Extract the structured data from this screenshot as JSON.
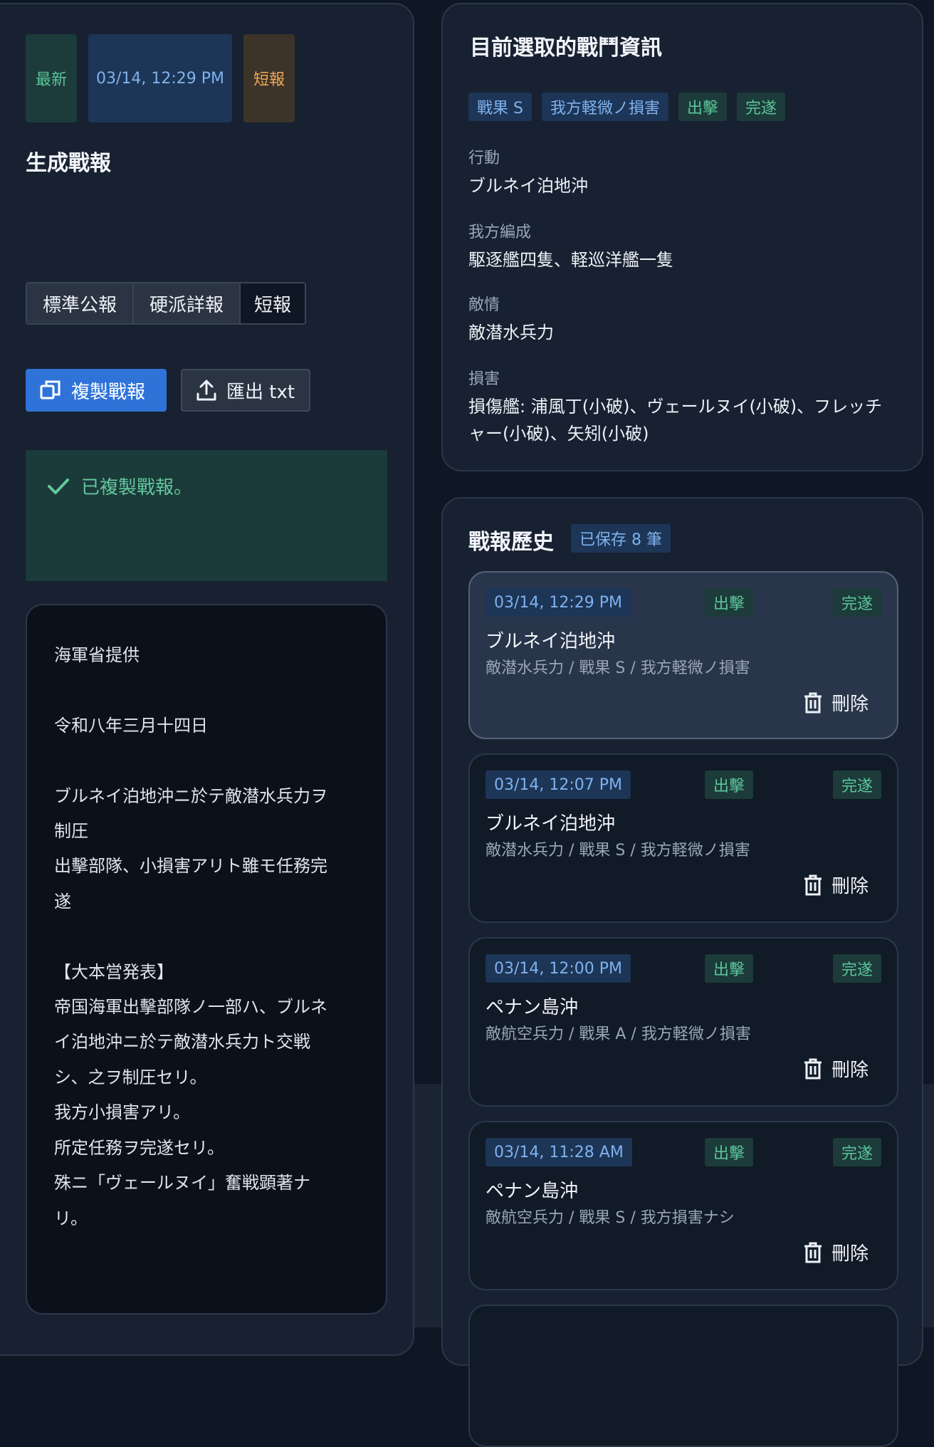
{
  "generator": {
    "chips": {
      "latest": "最新",
      "time": "03/14, 12:29 PM",
      "type": "短報"
    },
    "title": "生成戰報",
    "modes": [
      "標準公報",
      "硬派詳報",
      "短報"
    ],
    "copy_label": "複製戰報",
    "export_label": "匯出 txt",
    "alert_text": "已複製戰報。",
    "report_text": "海軍省提供\n\n令和八年三月十四日\n\nブルネイ泊地沖ニ於テ敵潜水兵力ヲ\n制圧\n出擊部隊、小損害アリト雖モ任務完\n遂\n\n【大本営発表】\n帝国海軍出擊部隊ノ一部ハ、ブルネ\nイ泊地沖ニ於テ敵潜水兵力ト交戦\nシ、之ヲ制圧セリ。\n我方小損害アリ。\n所定任務ヲ完遂セリ。\n殊ニ「ヴェールヌイ」奮戦顕著ナ\nリ。"
  },
  "selected": {
    "title": "目前選取的戰鬥資訊",
    "tags": [
      "戰果 S",
      "我方軽微ノ損害",
      "出擊",
      "完遂"
    ],
    "fields": [
      {
        "label": "行動",
        "value": "ブルネイ泊地沖"
      },
      {
        "label": "我方編成",
        "value": "駆逐艦四隻、軽巡洋艦一隻"
      },
      {
        "label": "敵情",
        "value": "敵潜水兵力"
      },
      {
        "label": "損害",
        "value": "損傷艦: 浦風丁(小破)、ヴェールヌイ(小破)、フレッチャー(小破)、矢矧(小破)"
      }
    ]
  },
  "history": {
    "title": "戰報歷史",
    "count": "已保存 8 筆",
    "delete_label": "刪除",
    "items": [
      {
        "time": "03/14, 12:29 PM",
        "sortie": "出擊",
        "status": "完遂",
        "location": "ブルネイ泊地沖",
        "summary": "敵潜水兵力 / 戰果 S / 我方軽微ノ損害"
      },
      {
        "time": "03/14, 12:07 PM",
        "sortie": "出擊",
        "status": "完遂",
        "location": "ブルネイ泊地沖",
        "summary": "敵潜水兵力 / 戰果 S / 我方軽微ノ損害"
      },
      {
        "time": "03/14, 12:00 PM",
        "sortie": "出擊",
        "status": "完遂",
        "location": "ペナン島沖",
        "summary": "敵航空兵力 / 戰果 A / 我方軽微ノ損害"
      },
      {
        "time": "03/14, 11:28 AM",
        "sortie": "出擊",
        "status": "完遂",
        "location": "ペナン島沖",
        "summary": "敵航空兵力 / 戰果 S / 我方損害ナシ"
      }
    ]
  }
}
